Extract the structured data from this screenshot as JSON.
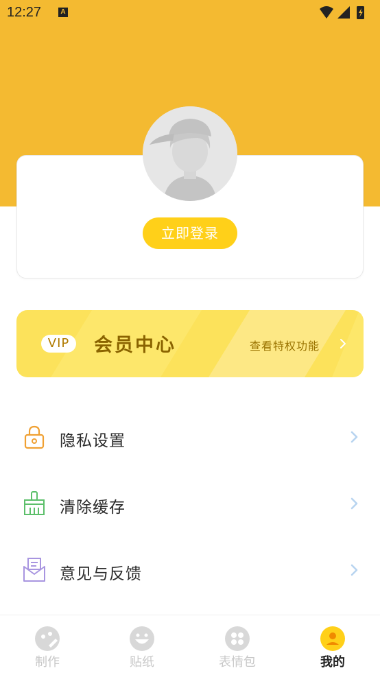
{
  "status_bar": {
    "time": "12:27",
    "notification_letter": "A"
  },
  "profile": {
    "login_label": "立即登录"
  },
  "vip": {
    "badge": "VIP",
    "title": "会员中心",
    "link": "查看特权功能"
  },
  "menu": [
    {
      "label": "隐私设置",
      "icon": "lock-icon"
    },
    {
      "label": "清除缓存",
      "icon": "broom-icon"
    },
    {
      "label": "意见与反馈",
      "icon": "envelope-icon"
    }
  ],
  "tabs": [
    {
      "label": "制作",
      "icon": "make-icon",
      "active": false
    },
    {
      "label": "贴纸",
      "icon": "sticker-icon",
      "active": false
    },
    {
      "label": "表情包",
      "icon": "emoji-pack-icon",
      "active": false
    },
    {
      "label": "我的",
      "icon": "profile-icon",
      "active": true
    }
  ],
  "colors": {
    "header": "#F4BA31",
    "accent": "#FFD019",
    "vip_bg": "#FCE25B",
    "tab_inactive": "#C8C8C8",
    "chevron": "#B8D4F0"
  }
}
